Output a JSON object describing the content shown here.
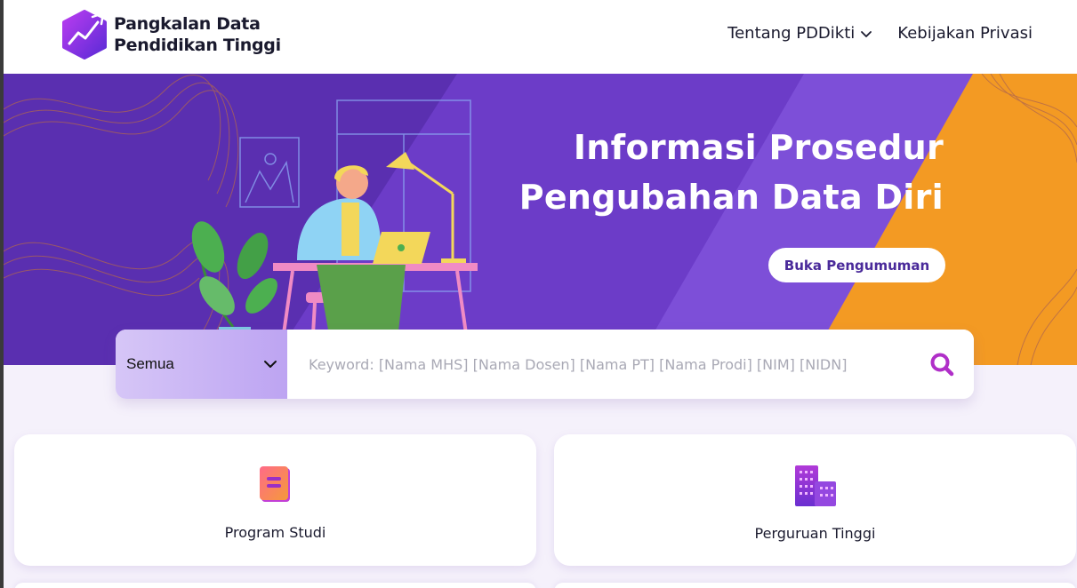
{
  "header": {
    "logo_line1": "Pangkalan Data",
    "logo_line2": "Pendidikan Tinggi",
    "nav": [
      {
        "label": "Tentang PDDikti",
        "has_dropdown": true
      },
      {
        "label": "Kebijakan Privasi",
        "has_dropdown": false
      }
    ]
  },
  "banner": {
    "title_line1": "Informasi Prosedur",
    "title_line2": "Pengubahan Data Diri",
    "button_label": "Buka Pengumuman"
  },
  "search": {
    "category_value": "Semua",
    "placeholder": "Keyword: [Nama MHS] [Nama Dosen] [Nama PT] [Nama Prodi] [NIM] [NIDN]",
    "icon": "search-icon"
  },
  "cards": [
    {
      "label": "Program Studi",
      "icon": "book-icon"
    },
    {
      "label": "Perguruan Tinggi",
      "icon": "building-icon"
    }
  ],
  "colors": {
    "brand_purple": "#6a2fd0",
    "banner_purple": "#5a2fb0",
    "banner_orange": "#f39a23",
    "accent_magenta": "#b02fc8"
  }
}
